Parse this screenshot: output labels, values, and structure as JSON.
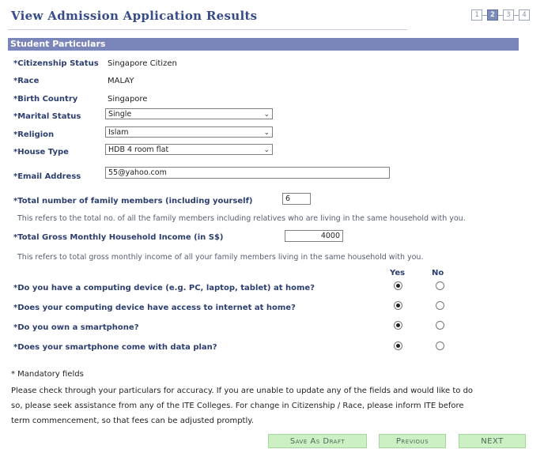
{
  "page": {
    "title": "View Admission Application Results",
    "steps": [
      "1",
      "2",
      "3",
      "4"
    ],
    "active_step": 1
  },
  "section": {
    "title": "Student Particulars"
  },
  "fields": {
    "citizenship": {
      "label": "*Citizenship Status",
      "value": "Singapore Citizen"
    },
    "race": {
      "label": "*Race",
      "value": "MALAY"
    },
    "birth_country": {
      "label": "*Birth Country",
      "value": "Singapore"
    },
    "marital_status": {
      "label": "*Marital Status",
      "value": "Single"
    },
    "religion": {
      "label": "*Religion",
      "value": "Islam"
    },
    "house_type": {
      "label": "*House Type",
      "value": "HDB 4 room flat"
    },
    "email": {
      "label": "*Email Address",
      "value": "55@yahoo.com"
    },
    "family_members": {
      "label": "*Total number of family members (including yourself)",
      "value": "6",
      "note": "This refers to the total no. of all the family members including relatives who are living in the same household with you."
    },
    "household_income": {
      "label": "*Total Gross Monthly Household Income (in S$)",
      "value": "4000",
      "note": "This refers to total gross monthly income of all your family members living in the same household with you."
    }
  },
  "questions": {
    "yes_label": "Yes",
    "no_label": "No",
    "items": [
      {
        "text": "*Do you have a computing device (e.g. PC, laptop, tablet) at home?",
        "answer": "yes"
      },
      {
        "text": "*Does your computing device have access to internet at home?",
        "answer": "yes"
      },
      {
        "text": "*Do you own a smartphone?",
        "answer": "yes"
      },
      {
        "text": "*Does your smartphone come with data plan?",
        "answer": "yes"
      }
    ]
  },
  "footer": {
    "mandatory": "* Mandatory fields",
    "lines": [
      "Please check through your particulars for accuracy. If you are unable to update any of the fields and would like to do",
      "so, please seek assistance from any of the ITE Colleges. For change in Citizenship / Race, please inform ITE before",
      "term commencement, so that fees can be adjusted promptly."
    ]
  },
  "buttons": {
    "save_draft": "Save As Draft",
    "previous": "Previous",
    "next": "NEXT"
  }
}
